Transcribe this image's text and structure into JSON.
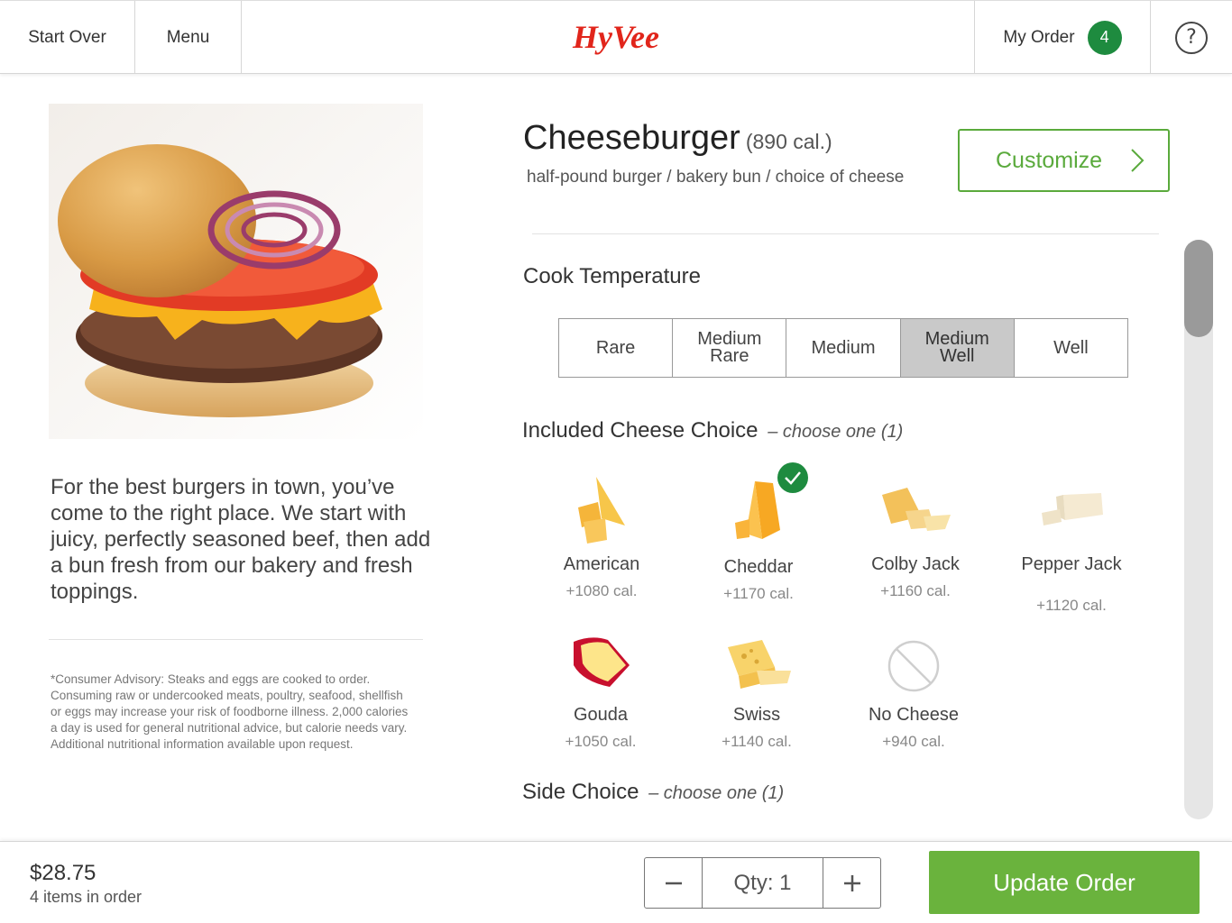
{
  "header": {
    "start_over": "Start Over",
    "menu": "Menu",
    "logo_text": "HyVee",
    "my_order_label": "My Order",
    "order_count": "4",
    "help_symbol": "?"
  },
  "product": {
    "name": "Cheeseburger",
    "calories": "(890 cal.)",
    "subtitle": "half-pound burger / bakery bun / choice of cheese",
    "description": "For the best burgers in town, you’ve come to the right place. We start with juicy, perfectly seasoned beef, then add a bun fresh from our bakery and fresh toppings.",
    "advisory": "*Consumer Advisory: Steaks and eggs are cooked to order. Consuming raw or undercooked meats, poultry, seafood, shellfish or eggs may increase your risk of foodborne illness. 2,000 calories a day is used for general nutritional advice, but calorie needs vary. Additional nutritional information available upon request.",
    "customize_label": "Customize"
  },
  "cook_temperature": {
    "heading": "Cook Temperature",
    "options": [
      {
        "label": "Rare"
      },
      {
        "label": "Medium Rare"
      },
      {
        "label": "Medium"
      },
      {
        "label": "Medium Well"
      },
      {
        "label": "Well"
      }
    ],
    "selected": "Medium Well"
  },
  "cheese_choice": {
    "heading": "Included Cheese Choice",
    "hint": "– choose one (1)",
    "options": [
      {
        "name": "American",
        "cal": "+1080 cal."
      },
      {
        "name": "Cheddar",
        "cal": "+1170 cal."
      },
      {
        "name": "Colby Jack",
        "cal": "+1160 cal."
      },
      {
        "name": "Pepper Jack",
        "cal": "+1120 cal."
      },
      {
        "name": "Gouda",
        "cal": "+1050 cal."
      },
      {
        "name": "Swiss",
        "cal": "+1140 cal."
      },
      {
        "name": "No Cheese",
        "cal": "+940 cal."
      }
    ],
    "selected": "Cheddar"
  },
  "side_choice": {
    "heading": "Side Choice",
    "hint": "– choose one (1)"
  },
  "footer": {
    "price": "$28.75",
    "items_in_order": "4 items in order",
    "qty_label": "Qty: 1",
    "update_order": "Update Order"
  },
  "colors": {
    "brand_red": "#e1251b",
    "accent_green": "#6ab33d",
    "badge_green": "#1e8b3f",
    "selected_segment": "#c9c9c9"
  }
}
